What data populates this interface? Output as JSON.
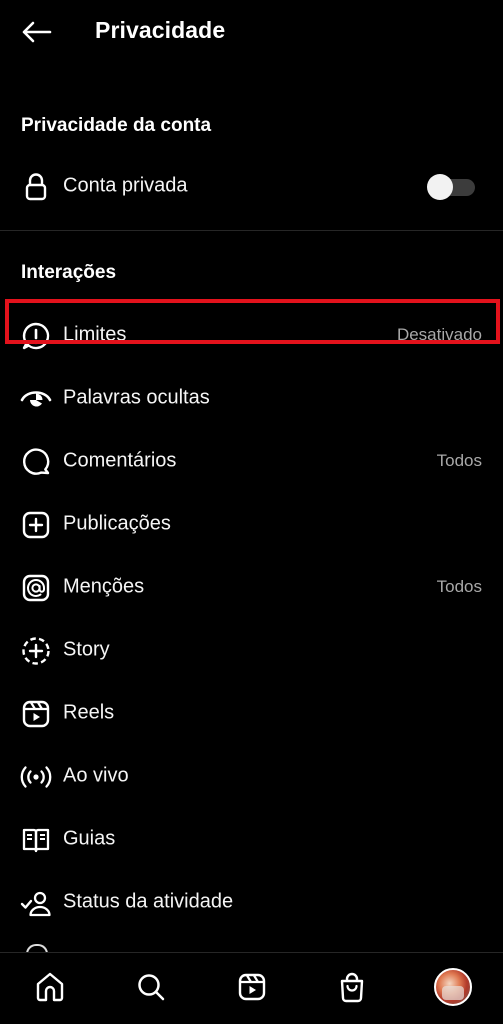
{
  "header": {
    "title": "Privacidade"
  },
  "account_section": {
    "title": "Privacidade da conta",
    "private_account": {
      "label": "Conta privada",
      "enabled": false
    }
  },
  "interactions": {
    "title": "Interações",
    "items": [
      {
        "label": "Limites",
        "value": "Desativado",
        "icon": "limits-icon"
      },
      {
        "label": "Palavras ocultas",
        "value": "",
        "icon": "hidden-words-icon"
      },
      {
        "label": "Comentários",
        "value": "Todos",
        "icon": "comment-icon"
      },
      {
        "label": "Publicações",
        "value": "",
        "icon": "plus-square-icon"
      },
      {
        "label": "Menções",
        "value": "Todos",
        "icon": "mention-icon"
      },
      {
        "label": "Story",
        "value": "",
        "icon": "story-icon"
      },
      {
        "label": "Reels",
        "value": "",
        "icon": "reels-icon"
      },
      {
        "label": "Ao vivo",
        "value": "",
        "icon": "live-icon"
      },
      {
        "label": "Guias",
        "value": "",
        "icon": "guides-icon"
      },
      {
        "label": "Status da atividade",
        "value": "",
        "icon": "activity-status-icon"
      }
    ]
  },
  "highlight_color": "#e3121c",
  "bottom_nav": [
    {
      "icon": "home-icon"
    },
    {
      "icon": "search-icon"
    },
    {
      "icon": "reels-icon"
    },
    {
      "icon": "shop-icon"
    },
    {
      "icon": "profile-avatar"
    }
  ]
}
